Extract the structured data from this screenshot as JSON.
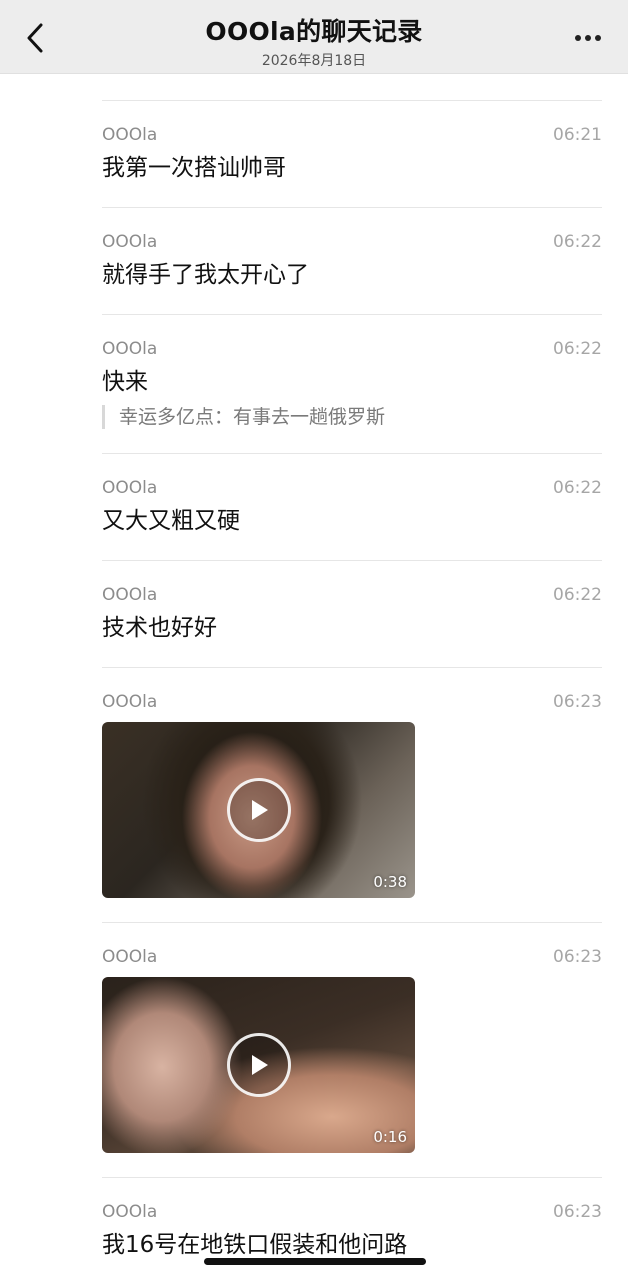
{
  "header": {
    "title": "OOOla的聊天记录",
    "subtitle": "2026年8月18日",
    "back_icon": "chevron-left-icon",
    "more_icon": "more-icon"
  },
  "messages": [
    {
      "sender": "OOOla",
      "time": "06:21",
      "type": "text",
      "text": "我第一次搭讪帅哥"
    },
    {
      "sender": "OOOla",
      "time": "06:22",
      "type": "text",
      "text": "就得手了我太开心了"
    },
    {
      "sender": "OOOla",
      "time": "06:22",
      "type": "text",
      "text": "快来",
      "quote": "幸运多亿点：有事去一趟俄罗斯"
    },
    {
      "sender": "OOOla",
      "time": "06:22",
      "type": "text",
      "text": "又大又粗又硬"
    },
    {
      "sender": "OOOla",
      "time": "06:22",
      "type": "text",
      "text": "技术也好好"
    },
    {
      "sender": "OOOla",
      "time": "06:23",
      "type": "video",
      "duration": "0:38"
    },
    {
      "sender": "OOOla",
      "time": "06:23",
      "type": "video",
      "duration": "0:16"
    },
    {
      "sender": "OOOla",
      "time": "06:23",
      "type": "text",
      "text": "我16号在地铁口假装和他问路"
    }
  ]
}
